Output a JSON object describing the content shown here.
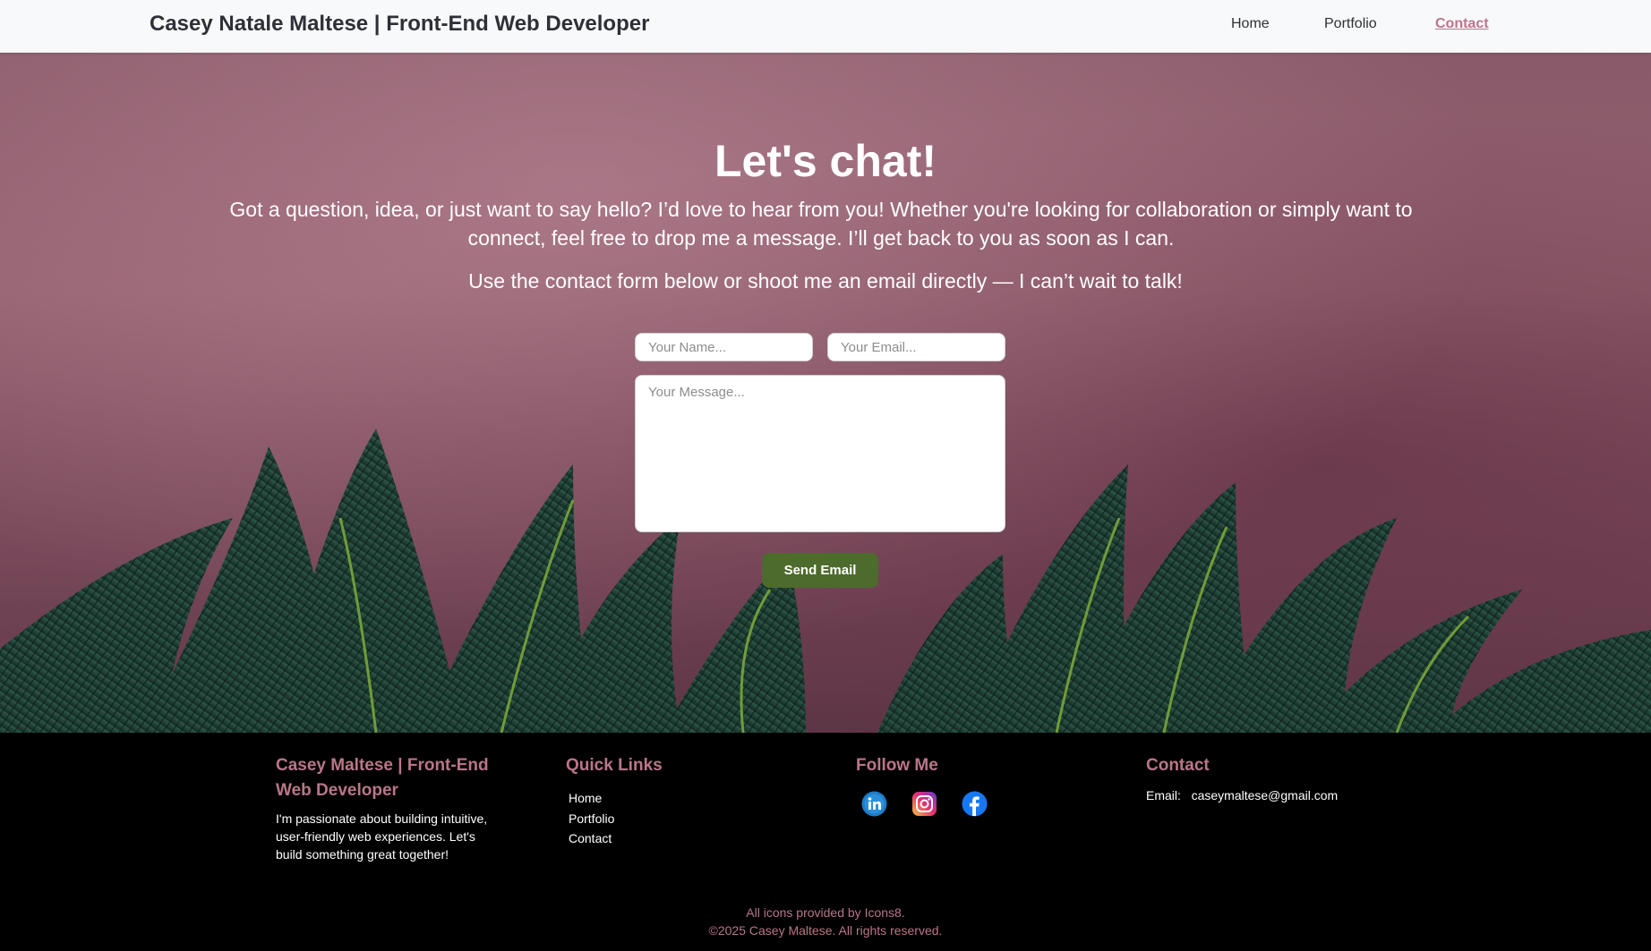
{
  "nav": {
    "brand": "Casey Natale Maltese | Front-End Web Developer",
    "links": [
      {
        "label": "Home",
        "active": false
      },
      {
        "label": "Portfolio",
        "active": false
      },
      {
        "label": "Contact",
        "active": true
      }
    ]
  },
  "hero": {
    "title": "Let's chat!",
    "paragraph": "Got a question, idea, or just want to say hello? I’d love to hear from you! Whether you're looking for collaboration or simply want to connect, feel free to drop me a message. I’ll get back to you as soon as I can.",
    "paragraph2": "Use the contact form below or shoot me an email directly — I can’t wait to talk!"
  },
  "form": {
    "name_placeholder": "Your Name...",
    "email_placeholder": "Your Email...",
    "message_placeholder": "Your Message...",
    "submit_label": "Send Email"
  },
  "footer": {
    "about": {
      "heading": "Casey Maltese | Front-End Web Developer",
      "text": "I'm passionate about building intuitive, user-friendly web experiences. Let's build something great together!"
    },
    "quick_links": {
      "heading": "Quick Links",
      "items": [
        "Home",
        "Portfolio",
        "Contact"
      ]
    },
    "follow": {
      "heading": "Follow Me",
      "icons": [
        "linkedin-icon",
        "instagram-icon",
        "facebook-icon"
      ]
    },
    "contact": {
      "heading": "Contact",
      "email_label": "Email:",
      "email": "caseymaltese@gmail.com"
    },
    "credit_line1": "All icons provided by Icons8.",
    "credit_line2": "©2025 Casey Maltese. All rights reserved."
  },
  "colors": {
    "accent": "#b97689",
    "button": "#4d6b2c",
    "navbar_bg": "#f8f9fa",
    "footer_bg": "#000000"
  }
}
